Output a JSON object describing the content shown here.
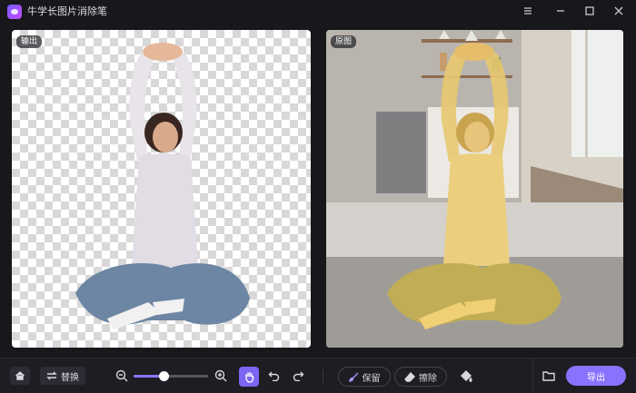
{
  "app": {
    "title": "牛学长图片消除笔"
  },
  "panels": {
    "left_label": "输出",
    "right_label": "原图"
  },
  "toolbar": {
    "swap_label": "替换",
    "keep_label": "保留",
    "erase_label": "擦除",
    "export_label": "导出",
    "zoom_level": 0.4
  },
  "colors": {
    "accent": "#8a72ff",
    "active_tool": "#7d64f2",
    "background": "#17171c",
    "mask_overlay": "#e8c870"
  },
  "icons": [
    "home-icon",
    "swap-icon",
    "zoom-out-icon",
    "zoom-in-icon",
    "hand-icon",
    "undo-icon",
    "redo-icon",
    "brush-icon",
    "eraser-icon",
    "paint-bucket-icon",
    "folder-icon",
    "menu-icon",
    "minimize-icon",
    "maximize-icon",
    "close-icon"
  ]
}
